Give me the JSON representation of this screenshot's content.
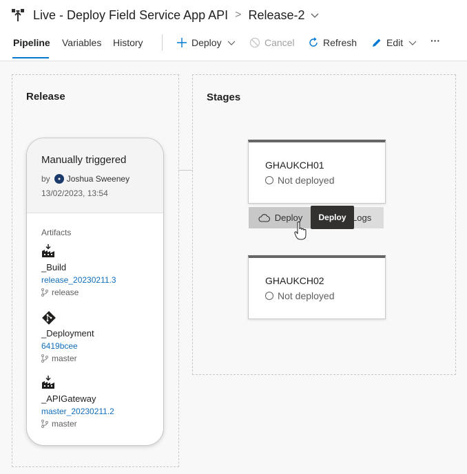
{
  "header": {
    "pipeline_title": "Live - Deploy Field Service App API",
    "separator": ">",
    "release_name": "Release-2"
  },
  "tabs": [
    {
      "label": "Pipeline",
      "active": true
    },
    {
      "label": "Variables",
      "active": false
    },
    {
      "label": "History",
      "active": false
    }
  ],
  "toolbar": {
    "deploy_label": "Deploy",
    "cancel_label": "Cancel",
    "refresh_label": "Refresh",
    "edit_label": "Edit",
    "more_label": "···"
  },
  "release_panel": {
    "title": "Release",
    "trigger": "Manually triggered",
    "by_label": "by",
    "user_name": "Joshua Sweeney",
    "date": "13/02/2023, 13:54",
    "artifacts_heading": "Artifacts",
    "artifacts": [
      {
        "name": "_Build",
        "version": "release_20230211.3",
        "branch": "release",
        "icon": "build-icon"
      },
      {
        "name": "_Deployment",
        "version": "6419bcee",
        "branch": "master",
        "icon": "git-icon"
      },
      {
        "name": "_APIGateway",
        "version": "master_20230211.2",
        "branch": "master",
        "icon": "build-icon"
      }
    ]
  },
  "stages_panel": {
    "title": "Stages",
    "stages": [
      {
        "name": "GHAUKCH01",
        "status": "Not deployed"
      },
      {
        "name": "GHAUKCH02",
        "status": "Not deployed"
      }
    ],
    "deploy_button": "Deploy",
    "logs_button": "Logs",
    "tooltip": "Deploy"
  }
}
